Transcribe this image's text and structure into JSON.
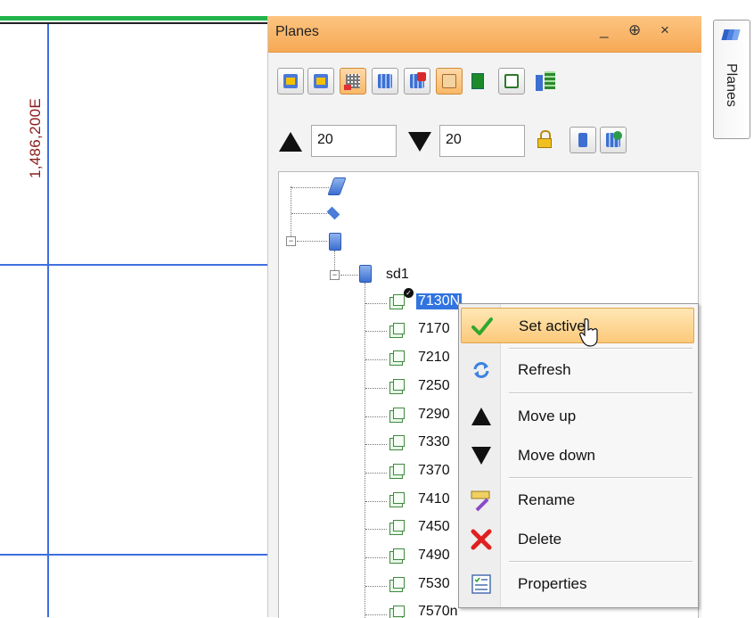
{
  "canvas": {
    "coordinate_label": "1,486,200E"
  },
  "panel": {
    "title": "Planes",
    "controls": {
      "minimize": "_",
      "pin": "⊕",
      "close": "×"
    },
    "toolbar_icons": [
      "plane-left-icon",
      "plane-right-icon",
      "grid-plane-icon",
      "plane-stack-icon",
      "delete-plane-icon",
      "plane-highlight-icon",
      "green-square-icon",
      "plane-grid-icon",
      "plane-edit-icon"
    ],
    "spin_up_value": "20",
    "spin_down_value": "20"
  },
  "tree": {
    "root_label": "sd1",
    "items": [
      "7130N",
      "7170",
      "7210",
      "7250",
      "7290",
      "7330",
      "7370",
      "7410",
      "7450",
      "7490",
      "7530",
      "7570n"
    ]
  },
  "context_menu": {
    "items": [
      {
        "label": "Set active",
        "icon": "check-icon"
      },
      {
        "label": "Refresh",
        "icon": "refresh-icon"
      },
      {
        "label": "Move up",
        "icon": "triangle-up-icon"
      },
      {
        "label": "Move down",
        "icon": "triangle-down-icon"
      },
      {
        "label": "Rename",
        "icon": "rename-icon"
      },
      {
        "label": "Delete",
        "icon": "delete-icon"
      },
      {
        "label": "Properties",
        "icon": "properties-icon"
      }
    ]
  },
  "side_tab": {
    "label": "Planes"
  },
  "colors": {
    "accent": "#f6a955",
    "selection": "#3174e0",
    "grid": "#3f6fe0",
    "coord": "#8b1b1b"
  }
}
